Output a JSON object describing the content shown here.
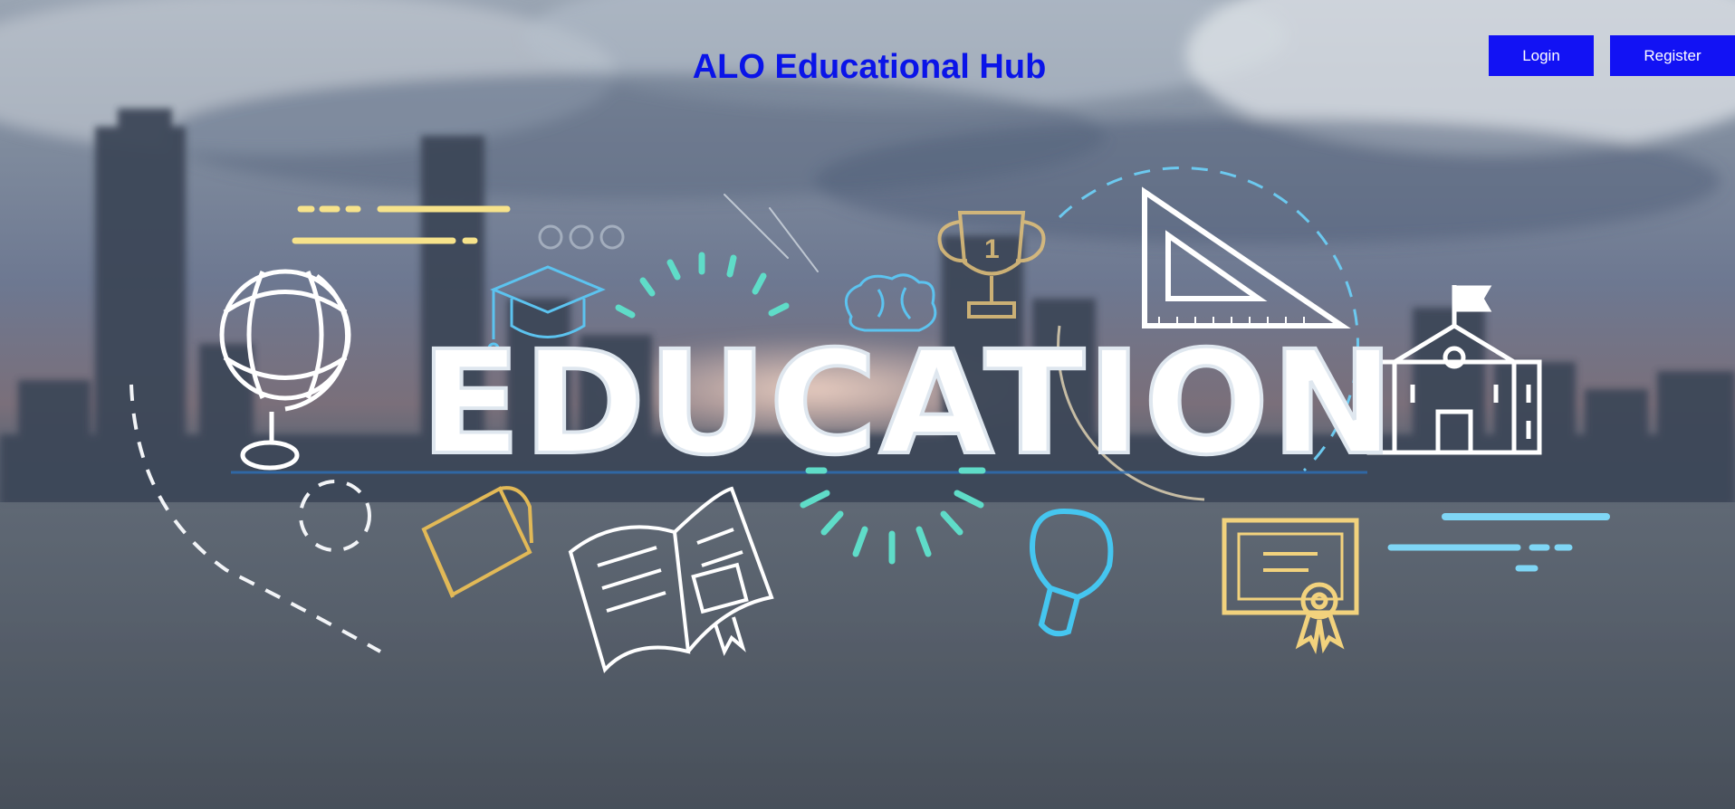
{
  "header": {
    "title": "ALO Educational Hub",
    "login_label": "Login",
    "register_label": "Register"
  },
  "hero": {
    "banner_word": "EDUCATION"
  },
  "colors": {
    "title": "#0a14e8",
    "button_bg": "#1212f4",
    "button_text": "#ffffff",
    "accent_yellow": "#f2c24e",
    "accent_cyan": "#45c6f0",
    "accent_teal": "#4fd8c4"
  },
  "icons": [
    "globe-icon",
    "graduation-cap-icon",
    "brain-icon",
    "trophy-icon",
    "set-square-icon",
    "school-building-icon",
    "closed-book-icon",
    "open-book-icon",
    "light-bulb-icon",
    "certificate-icon"
  ]
}
